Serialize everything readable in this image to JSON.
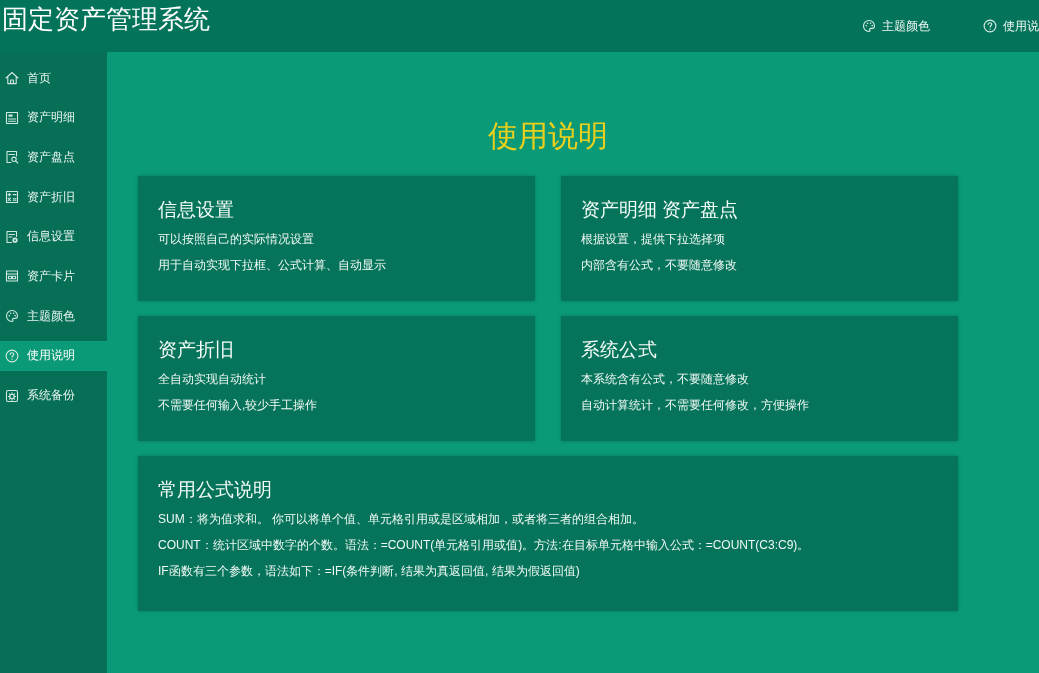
{
  "header": {
    "title": "固定资产管理系统",
    "actions": [
      {
        "label": "主题颜色"
      },
      {
        "label": "使用说"
      }
    ]
  },
  "sidebar": {
    "items": [
      {
        "label": "首页",
        "selected": false
      },
      {
        "label": "资产明细",
        "selected": false
      },
      {
        "label": "资产盘点",
        "selected": false
      },
      {
        "label": "资产折旧",
        "selected": false
      },
      {
        "label": "信息设置",
        "selected": false
      },
      {
        "label": "资产卡片",
        "selected": false
      },
      {
        "label": "主题颜色",
        "selected": false
      },
      {
        "label": "使用说明",
        "selected": true
      },
      {
        "label": "系统备份",
        "selected": false
      }
    ]
  },
  "main": {
    "title": "使用说明",
    "cards": [
      {
        "title": "信息设置",
        "lines": [
          "可以按照自己的实际情况设置",
          "用于自动实现下拉框、公式计算、自动显示"
        ]
      },
      {
        "title": "资产明细 资产盘点",
        "lines": [
          "根据设置，提供下拉选择项",
          "内部含有公式，不要随意修改"
        ]
      },
      {
        "title": "资产折旧",
        "lines": [
          "全自动实现自动统计",
          "不需要任何输入,较少手工操作"
        ]
      },
      {
        "title": "系统公式",
        "lines": [
          "本系统含有公式，不要随意修改",
          "自动计算统计，不需要任何修改，方便操作"
        ]
      }
    ],
    "formula_note": {
      "title": "常用公式说明",
      "lines": [
        "SUM：将为值求和。 你可以将单个值、单元格引用或是区域相加，或者将三者的组合相加。",
        "COUNT：统计区域中数字的个数。语法：=COUNT(单元格引用或值)。方法:在目标单元格中输入公式：=COUNT(C3:C9)。",
        "IF函数有三个参数，语法如下：=IF(条件判断, 结果为真返回值, 结果为假返回值)"
      ]
    }
  }
}
